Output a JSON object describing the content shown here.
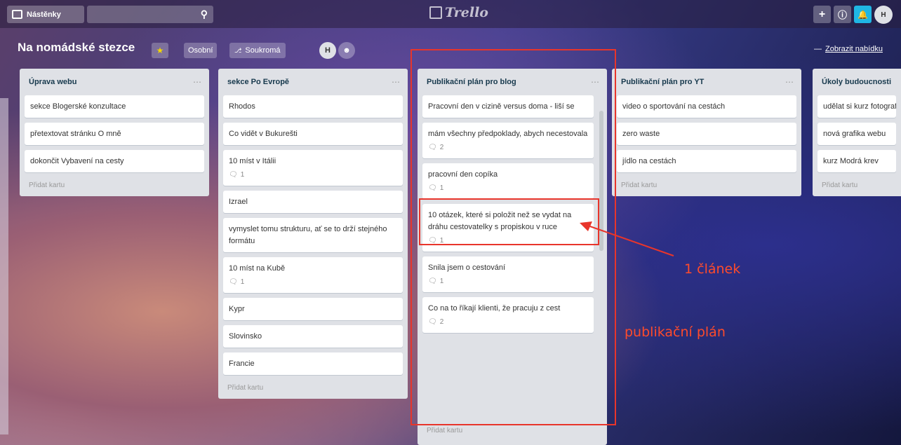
{
  "header": {
    "boards_label": "Nástěnky",
    "logo_text": "Trello",
    "avatar_initial": "H"
  },
  "board": {
    "title": "Na nomádské stezce",
    "team_label": "Osobní",
    "visibility_label": "Soukromá",
    "member_initial": "H",
    "show_menu_label": "Zobrazit nabídku"
  },
  "lists": [
    {
      "title": "Úprava webu",
      "cards": [
        {
          "text": "sekce Blogerské konzultace"
        },
        {
          "text": "přetextovat stránku O mně"
        },
        {
          "text": "dokončit Vybavení na cesty"
        }
      ],
      "add_label": "Přidat kartu"
    },
    {
      "title": "sekce Po Evropě",
      "cards": [
        {
          "text": "Rhodos"
        },
        {
          "text": "Co vidět v Bukurešti"
        },
        {
          "text": "10 míst v Itálii",
          "comments": "1"
        },
        {
          "text": "Izrael"
        },
        {
          "text": "vymyslet tomu strukturu, ať se to drží stejného formátu"
        },
        {
          "text": "10 míst na Kubě",
          "comments": "1"
        },
        {
          "text": "Kypr"
        },
        {
          "text": "Slovinsko"
        },
        {
          "text": "Francie"
        }
      ],
      "add_label": "Přidat kartu"
    },
    {
      "title": "Publikační plán pro blog",
      "cards": [
        {
          "text": "Pracovní den v cizině versus doma - liší se"
        },
        {
          "text": "mám všechny předpoklady, abych necestovala",
          "comments": "2"
        },
        {
          "text": "pracovní den copíka",
          "comments": "1"
        },
        {
          "text": "10 otázek, které si položit než se vydat na dráhu cestovatelky s propiskou v ruce",
          "comments": "1"
        },
        {
          "text": "Snila jsem o cestování",
          "comments": "1"
        },
        {
          "text": "Co na to říkají klienti, že pracuju z cest",
          "comments": "2"
        }
      ],
      "add_label": "Přidat kartu"
    },
    {
      "title": "Publikační plán pro YT",
      "cards": [
        {
          "text": "video o sportování na cestách"
        },
        {
          "text": "zero waste"
        },
        {
          "text": "jídlo na cestách"
        }
      ],
      "add_label": "Přidat kartu"
    },
    {
      "title": "Úkoly budoucnosti",
      "cards": [
        {
          "text": "udělat si kurz fotografování"
        },
        {
          "text": "nová grafika webu"
        },
        {
          "text": "kurz Modrá krev"
        }
      ],
      "add_label": "Přidat kartu"
    }
  ],
  "annotations": {
    "article_label": "1 článek",
    "plan_label": "publikační plán",
    "color": "#e8352b"
  }
}
